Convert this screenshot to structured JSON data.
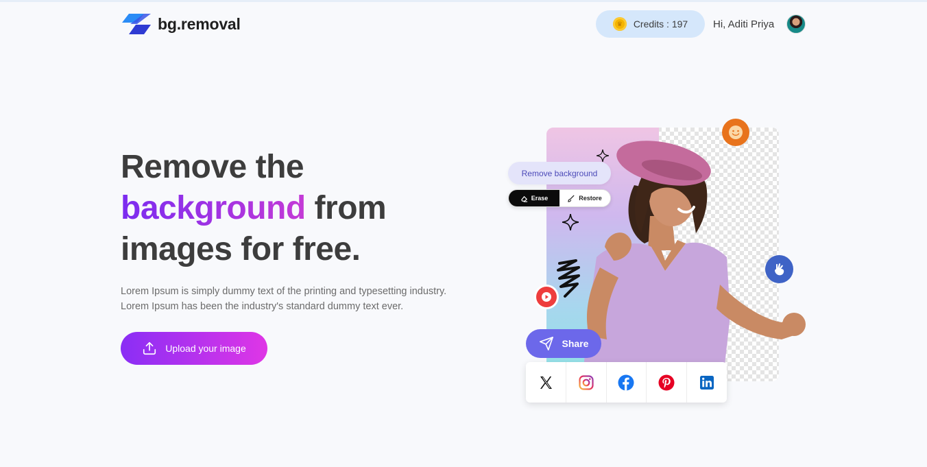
{
  "brand": {
    "name": "bg.removal",
    "accent": "#7b2cf0"
  },
  "header": {
    "credits_label": "Credits : 197",
    "greeting": "Hi, Aditi Priya"
  },
  "hero": {
    "title_line1": "Remove the",
    "title_accent": "background",
    "title_after_accent": " from",
    "title_line3": "images for free.",
    "desc_line1": "Lorem Ipsum is simply dummy text of the printing and typesetting industry.",
    "desc_line2": "Lorem Ipsum has been the industry's standard dummy text ever.",
    "upload_label": "Upload your image"
  },
  "illustration": {
    "remove_bg_label": "Remove background",
    "erase_label": "Erase",
    "restore_label": "Restore",
    "share_label": "Share",
    "socials": [
      "x-icon",
      "instagram-icon",
      "facebook-icon",
      "pinterest-icon",
      "linkedin-icon"
    ]
  },
  "colors": {
    "button_gradient_start": "#8a2ef5",
    "button_gradient_end": "#df36e6",
    "share_button": "#6c68ea",
    "credits_pill": "#d5e7fb"
  }
}
